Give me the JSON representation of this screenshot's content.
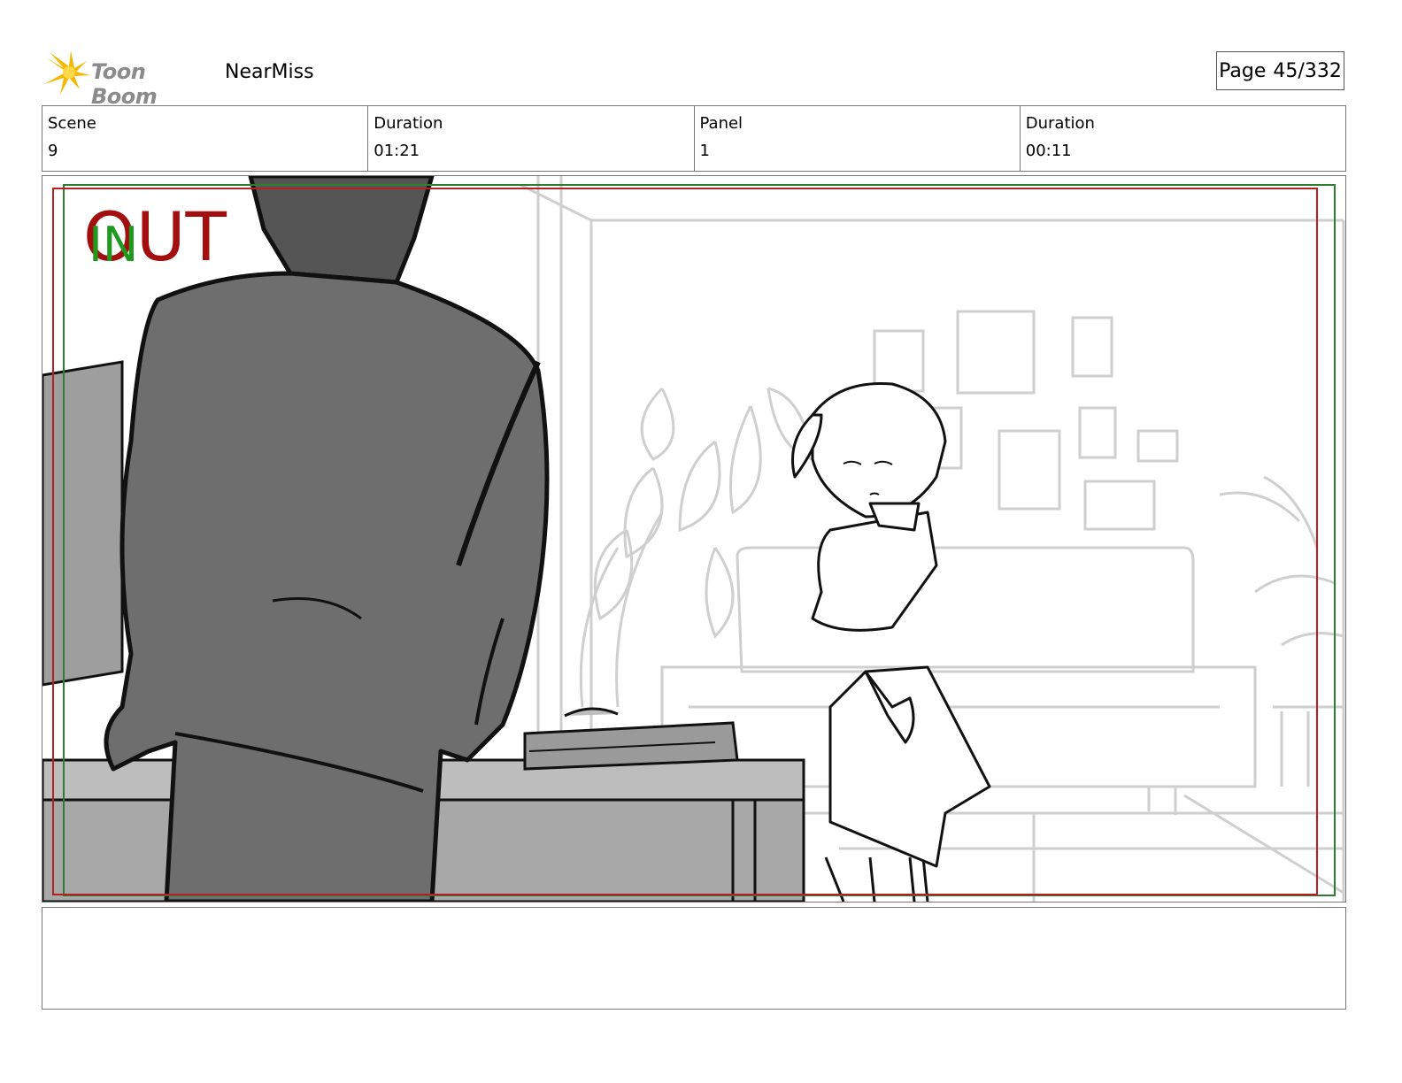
{
  "header": {
    "logo_text": "Toon Boom",
    "project_name": "NearMiss",
    "page_label": "Page",
    "page_value": "45/332"
  },
  "info": [
    {
      "label": "Scene",
      "value": "9"
    },
    {
      "label": "Duration",
      "value": "01:21"
    },
    {
      "label": "Panel",
      "value": "1"
    },
    {
      "label": "Duration",
      "value": "00:11"
    }
  ],
  "panel": {
    "out_mark": "OUT",
    "in_mark": "IN",
    "colors": {
      "out": "#a30f0f",
      "in": "#1f9a1f",
      "frame_red": "#b52020",
      "frame_green": "#2e7d32"
    }
  },
  "notes": {
    "text": ""
  }
}
